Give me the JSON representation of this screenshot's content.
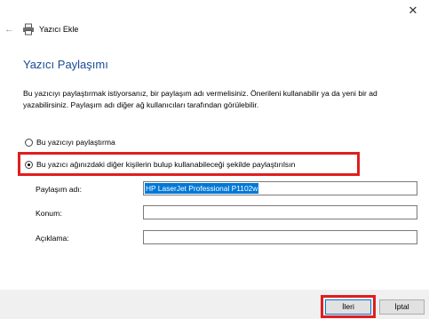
{
  "window": {
    "title": "Yazıcı Ekle"
  },
  "page": {
    "heading": "Yazıcı Paylaşımı",
    "description": "Bu yazıcıyı paylaştırmak istiyorsanız, bir paylaşım adı vermelisiniz. Önerileni kullanabilir ya da yeni bir ad yazabilirsiniz. Paylaşım adı diğer ağ kullanıcıları tarafından görülebilir."
  },
  "options": {
    "no_share": {
      "label": "Bu yazıcıyı paylaştırma",
      "selected": false
    },
    "share": {
      "label": "Bu yazıcı ağınızdaki diğer kişilerin bulup kullanabileceği şekilde paylaştırılsın",
      "selected": true
    }
  },
  "form": {
    "share_name": {
      "label": "Paylaşım adı:",
      "value": "HP LaserJet Professional P1102w"
    },
    "location": {
      "label": "Konum:",
      "value": ""
    },
    "comment": {
      "label": "Açıklama:",
      "value": ""
    }
  },
  "buttons": {
    "next": "İleri",
    "cancel": "İptal"
  },
  "colors": {
    "heading": "#1a4a96",
    "highlight": "#e01e1e",
    "selection": "#0078d7"
  }
}
